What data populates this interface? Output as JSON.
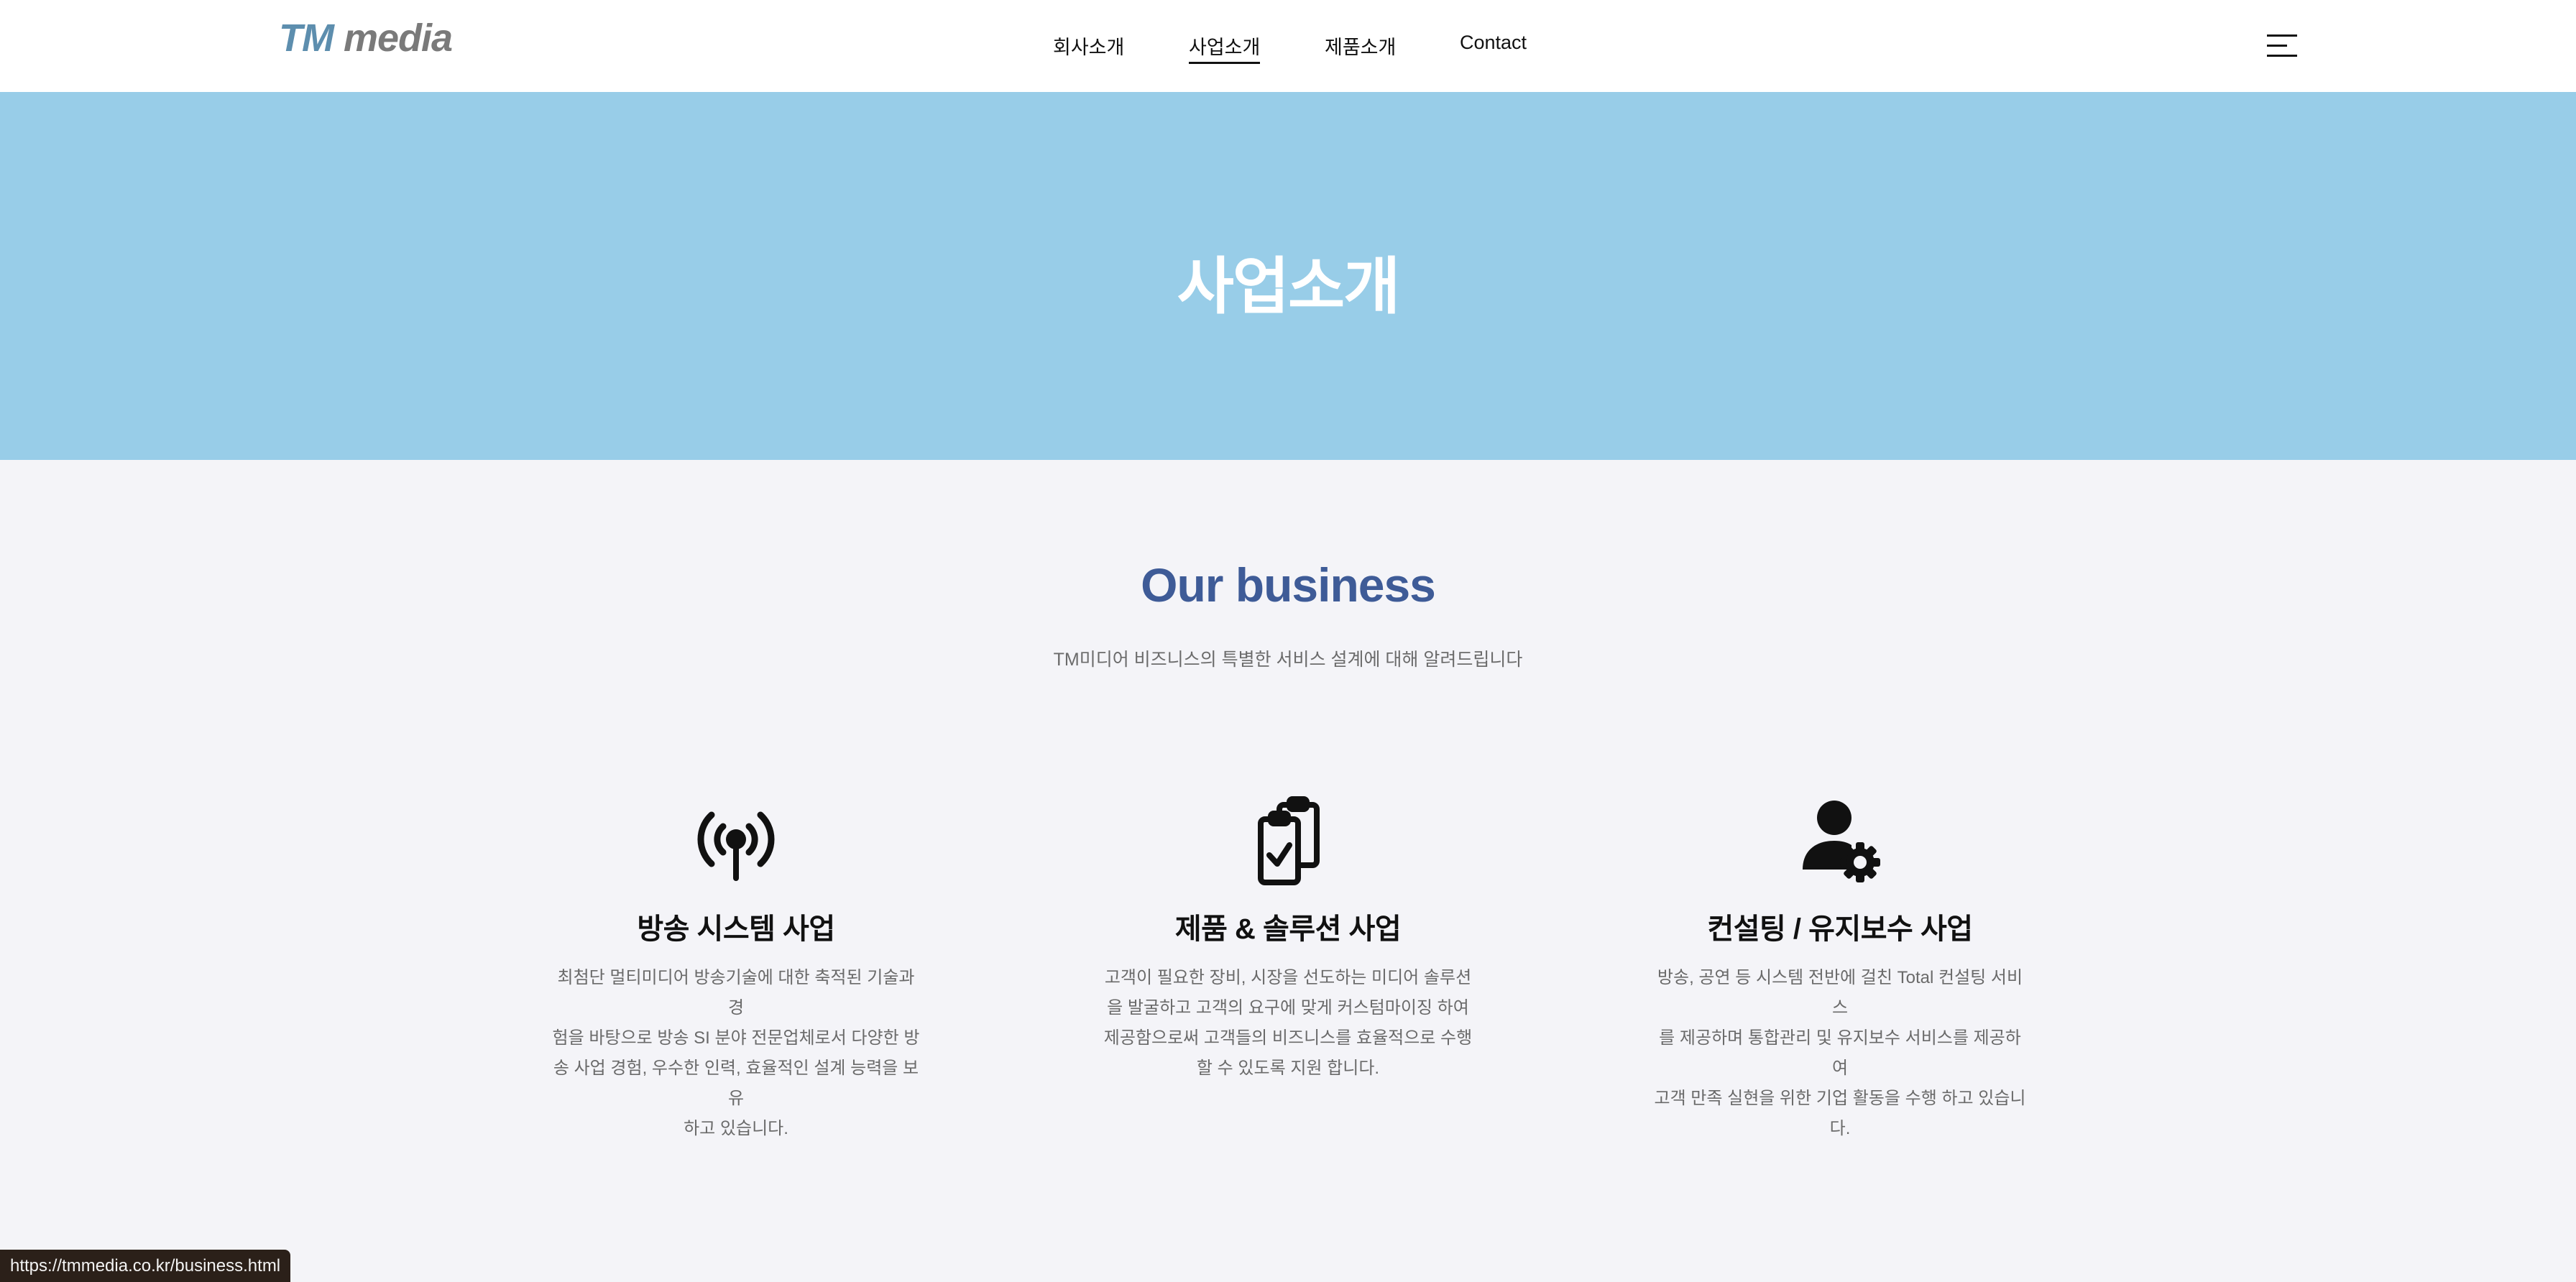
{
  "header": {
    "logo_tm": "TM",
    "logo_media": "media",
    "nav": [
      "회사소개",
      "사업소개",
      "제품소개",
      "Contact"
    ]
  },
  "hero": {
    "title": "사업소개"
  },
  "business": {
    "title": "Our business",
    "subtitle": "TM미디어 비즈니스의 특별한 서비스 설계에 대해 알려드립니다",
    "cards": [
      {
        "icon": "antenna-icon",
        "title": "방송 시스템 사업",
        "lines": [
          "최첨단 멀티미디어 방송기술에 대한 축적된 기술과 경",
          "험을 바탕으로 방송 SI 분야 전문업체로서 다양한 방",
          "송 사업 경험, 우수한 인력, 효율적인 설계 능력을 보유",
          "하고 있습니다."
        ]
      },
      {
        "icon": "clipboard-check-icon",
        "title": "제품 & 솔루션 사업",
        "lines": [
          "고객이 필요한 장비, 시장을 선도하는 미디어 솔루션",
          "을 발굴하고 고객의 요구에 맞게 커스텀마이징 하여",
          "제공함으로써 고객들의 비즈니스를 효율적으로 수행",
          "할 수 있도록 지원 합니다."
        ]
      },
      {
        "icon": "user-gear-icon",
        "title": "컨설팅 / 유지보수 사업",
        "lines": [
          "방송, 공연 등 시스템 전반에 걸친 Total 컨설팅 서비스",
          "를 제공하며 통합관리 및 유지보수 서비스를 제공하여",
          "고객 만족 실현을 위한 기업 활동을 수행 하고 있습니",
          "다."
        ]
      }
    ]
  },
  "status_bar": {
    "url": "https://tmmedia.co.kr/business.html"
  }
}
